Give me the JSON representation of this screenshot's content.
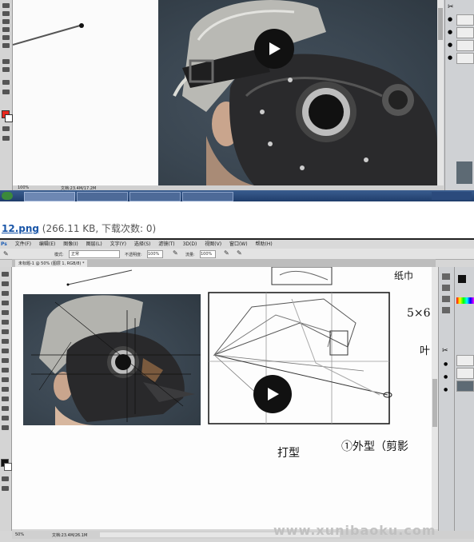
{
  "top_screenshot": {
    "zoom": "100%",
    "doc_info": "文档:23.4M/17.2M",
    "taskbar_items": [
      "",
      "",
      "",
      "",
      ""
    ]
  },
  "caption": {
    "filename": "12.png",
    "meta": " (266.11 KB, 下载次数: 0)"
  },
  "second_screenshot": {
    "menu": [
      "文件(F)",
      "编辑(E)",
      "图像(I)",
      "图层(L)",
      "文字(Y)",
      "选择(S)",
      "滤镜(T)",
      "3D(D)",
      "视图(V)",
      "窗口(W)",
      "帮助(H)"
    ],
    "options": {
      "mode_label": "模式:",
      "mode_value": "正常",
      "opacity_label": "不透明度:",
      "opacity_value": "100%",
      "flow_label": "流量:",
      "flow_value": "100%"
    },
    "tab": "未标题-1 @ 50% (图层 1, RGB/8) *",
    "handwriting": {
      "top_right": "纸巾",
      "size_note": "5×6",
      "mid_note": "叶",
      "step1": "打型",
      "step2": "①外型（剪影"
    },
    "status": {
      "zoom": "50%",
      "doc_info": "文档:23.4M/26.1M"
    },
    "watermark": "www.xunibaoku.com"
  },
  "colors": {
    "foreground": "#e8281e",
    "background": "#ffffff",
    "link": "#1a56a8"
  }
}
